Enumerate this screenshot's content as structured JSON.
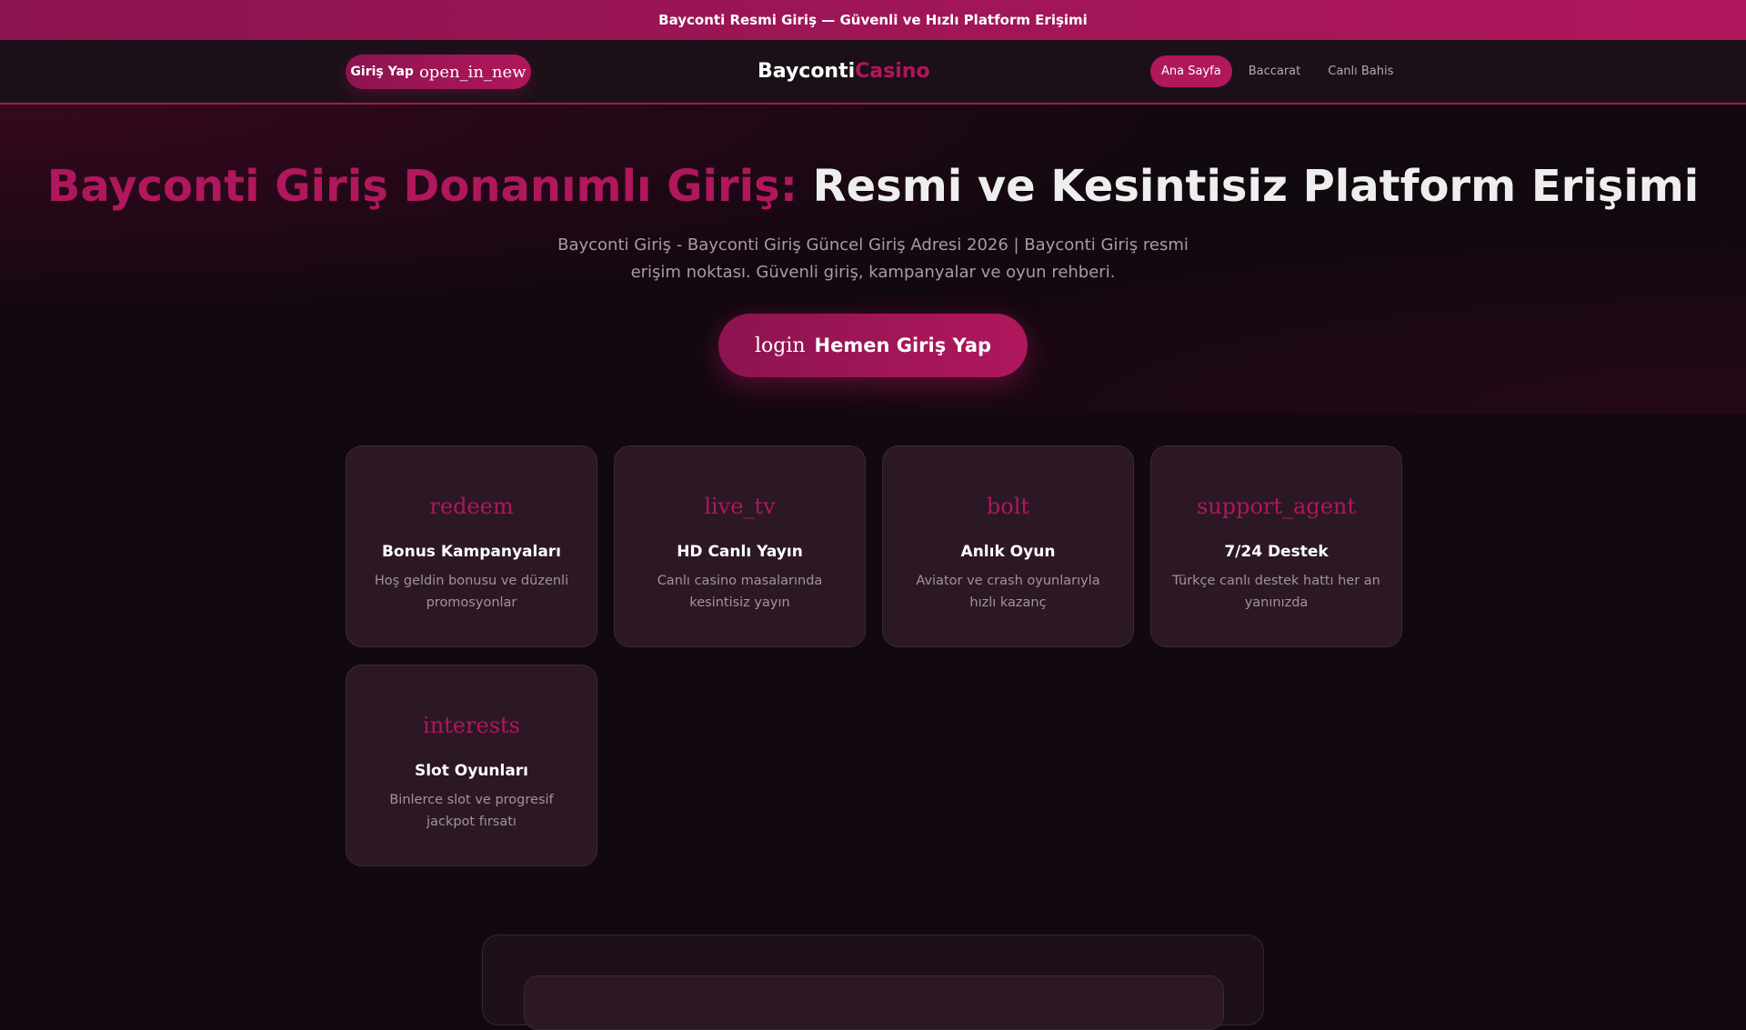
{
  "topbar": {
    "text": "Bayconti Resmi Giriş — Güvenli ve Hızlı Platform Erişimi"
  },
  "header": {
    "login_label": "Giriş Yap",
    "login_icon": "open_in_new",
    "logo_main": "Bayconti",
    "logo_accent": "Casino",
    "nav": [
      {
        "label": "Ana Sayfa"
      },
      {
        "label": "Baccarat"
      },
      {
        "label": "Canlı Bahis"
      }
    ]
  },
  "hero": {
    "title_accent": "Bayconti Giriş Donanımlı Giriş:",
    "title_rest": "Resmi ve Kesintisiz Platform Erişimi",
    "subtitle": "Bayconti Giriş - Bayconti Giriş Güncel Giriş Adresi 2026 | Bayconti Giriş resmi erişim noktası. Güvenli giriş, kampanyalar ve oyun rehberi.",
    "cta_icon": "login",
    "cta_label": "Hemen Giriş Yap"
  },
  "features": [
    {
      "icon": "redeem",
      "title": "Bonus Kampanyaları",
      "desc": "Hoş geldin bonusu ve düzenli promosyonlar"
    },
    {
      "icon": "live_tv",
      "title": "HD Canlı Yayın",
      "desc": "Canlı casino masalarında kesintisiz yayın"
    },
    {
      "icon": "bolt",
      "title": "Anlık Oyun",
      "desc": "Aviator ve crash oyunlarıyla hızlı kazanç"
    },
    {
      "icon": "support_agent",
      "title": "7/24 Destek",
      "desc": "Türkçe canlı destek hattı her an yanınızda"
    },
    {
      "icon": "interests",
      "title": "Slot Oyunları",
      "desc": "Binlerce slot ve progresif jackpot fırsatı"
    }
  ],
  "colors": {
    "accent": "#b0175c",
    "bg": "#12080f",
    "card": "#2b1824"
  }
}
